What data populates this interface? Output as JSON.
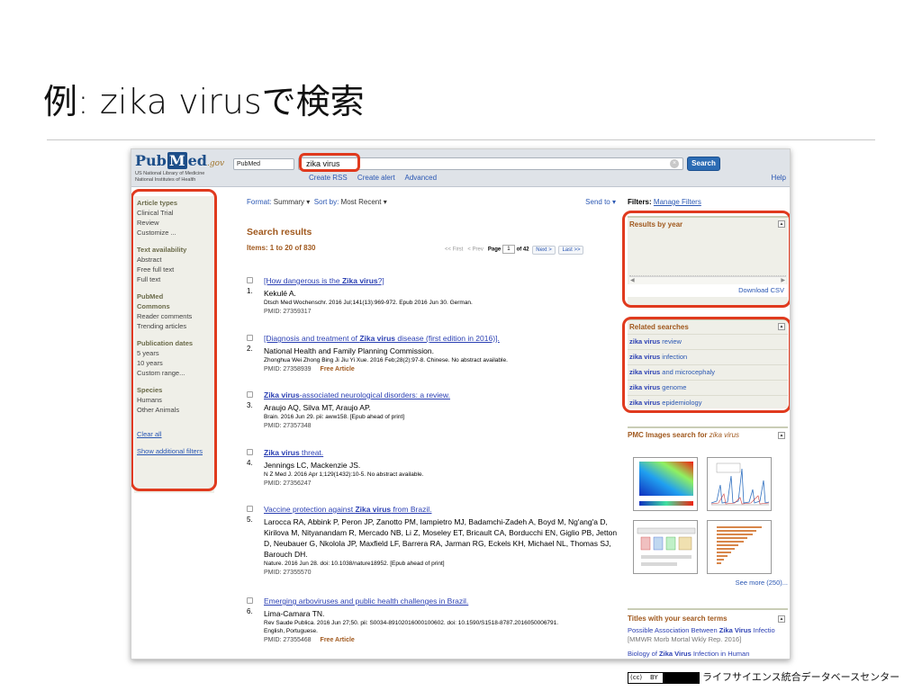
{
  "slide": {
    "title": "例: zika virusで検索",
    "footer": "ライフサイエンス統合データベースセンター",
    "license": {
      "cc": "(cc)",
      "by": "BY"
    }
  },
  "header": {
    "logo_pub": "Pub",
    "logo_m": "M",
    "logo_ed": "ed",
    "logo_gov": ".gov",
    "library_line1": "US National Library of Medicine",
    "library_line2": "National Institutes of Health",
    "database": "PubMed",
    "query": "zika virus",
    "search_button": "Search",
    "links": [
      "Create RSS",
      "Create alert",
      "Advanced"
    ],
    "help": "Help"
  },
  "sidebar": {
    "sections": [
      {
        "heading": "Article types",
        "items": [
          "Clinical Trial",
          "Review",
          "Customize ..."
        ]
      },
      {
        "heading": "Text availability",
        "items": [
          "Abstract",
          "Free full text",
          "Full text"
        ]
      },
      {
        "heading": "PubMed Commons",
        "items": [
          "Reader comments",
          "Trending articles"
        ]
      },
      {
        "heading": "Publication dates",
        "items": [
          "5 years",
          "10 years",
          "Custom range..."
        ]
      },
      {
        "heading": "Species",
        "items": [
          "Humans",
          "Other Animals"
        ]
      }
    ],
    "clear_all": "Clear all",
    "show_additional": "Show additional filters"
  },
  "toolbar": {
    "format_label": "Format:",
    "format_value": "Summary",
    "sort_label": "Sort by:",
    "sort_value": "Most Recent",
    "send_to": "Send to"
  },
  "results": {
    "heading": "Search results",
    "items_label": "Items: 1 to 20 of 830",
    "pager": {
      "first": "<< First",
      "prev": "< Prev",
      "page_label": "Page",
      "page_value": "1",
      "of": "of 42",
      "next": "Next >",
      "last": "Last >>"
    },
    "list": [
      {
        "num": "1.",
        "title_pre": "[How dangerous is the ",
        "title_bold": "Zika virus",
        "title_post": "?]",
        "authors": "Kekulé A.",
        "cite": "Dtsch Med Wochenschr. 2016 Jul;141(13):969-972. Epub 2016 Jun 30. German.",
        "pmid": "PMID: 27359317",
        "free": ""
      },
      {
        "num": "2.",
        "title_pre": "[Diagnosis and treatment of ",
        "title_bold": "Zika virus",
        "title_post": " disease (first edition in 2016)].",
        "authors": "National Health and Family Planning Commission.",
        "cite": "Zhonghua Wei Zhong Bing Ji Jiu Yi Xue. 2016 Feb;28(2):97-8. Chinese. No abstract available.",
        "pmid": "PMID: 27358939",
        "free": "Free Article"
      },
      {
        "num": "3.",
        "title_pre": "",
        "title_bold": "Zika virus",
        "title_post": "-associated neurological disorders: a review.",
        "authors": "Araujo AQ, Silva MT, Araujo AP.",
        "cite": "Brain. 2016 Jun 29. pii: aww158. [Epub ahead of print]",
        "pmid": "PMID: 27357348",
        "free": ""
      },
      {
        "num": "4.",
        "title_pre": "",
        "title_bold": "Zika virus",
        "title_post": " threat.",
        "authors": "Jennings LC, Mackenzie JS.",
        "cite": "N Z Med J. 2016 Apr 1;129(1432):10-5. No abstract available.",
        "pmid": "PMID: 27356247",
        "free": ""
      },
      {
        "num": "5.",
        "title_pre": "Vaccine protection against ",
        "title_bold": "Zika virus",
        "title_post": " from Brazil.",
        "authors": "Larocca RA, Abbink P, Peron JP, Zanotto PM, Iampietro MJ, Badamchi-Zadeh A, Boyd M, Ng'ang'a D, Kirilova M, Nityanandam R, Mercado NB, Li Z, Moseley ET, Bricault CA, Borducchi EN, Giglio PB, Jetton D, Neubauer G, Nkolola JP, Maxfield LF, Barrera RA, Jarman RG, Eckels KH, Michael NL, Thomas SJ, Barouch DH.",
        "cite": "Nature. 2016 Jun 28. doi: 10.1038/nature18952. [Epub ahead of print]",
        "pmid": "PMID: 27355570",
        "free": ""
      },
      {
        "num": "6.",
        "title_pre": "Emerging arboviruses and public health challenges in Brazil.",
        "title_bold": "",
        "title_post": "",
        "authors": "Lima-Camara TN.",
        "cite": "Rev Saude Publica. 2016 Jun 27;50. pii: S0034-89102016000100602. doi: 10.1590/S1518-8787.2016050006791. English, Portuguese.",
        "pmid": "PMID: 27355468",
        "free": "Free Article"
      }
    ]
  },
  "right": {
    "filters_label": "Filters:",
    "manage_filters": "Manage Filters",
    "results_by_year": "Results by year",
    "download_csv": "Download CSV",
    "related_heading": "Related searches",
    "related": [
      {
        "bold": "zika virus",
        "rest": " review"
      },
      {
        "bold": "zika virus",
        "rest": " infection"
      },
      {
        "bold": "zika virus",
        "rest": " and microcephaly"
      },
      {
        "bold": "zika virus",
        "rest": " genome"
      },
      {
        "bold": "zika virus",
        "rest": " epidemiology"
      }
    ],
    "pmc_heading": "PMC Images search for ",
    "pmc_query": "zika virus",
    "see_more": "See more (250)...",
    "titles_heading": "Titles with your search terms",
    "titles": [
      {
        "pre": "Possible Association Between ",
        "bold": "Zika Virus",
        "post": " Infectio",
        "gray": " [MMWR Morb Mortal Wkly Rep. 2016]"
      },
      {
        "pre": "Biology of ",
        "bold": "Zika Virus",
        "post": " Infection in Human",
        "gray": ""
      }
    ]
  },
  "colors": {
    "highlight": "#e03a1e",
    "link": "#2a57b3",
    "accent_brown": "#a0581d",
    "button_blue": "#2c6cb4"
  }
}
